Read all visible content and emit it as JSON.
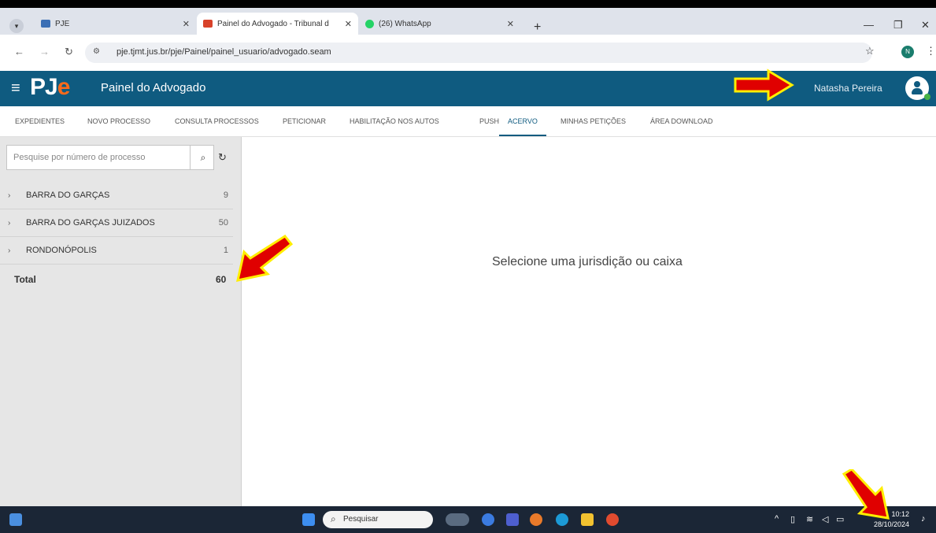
{
  "browser": {
    "tabs": [
      {
        "label": "PJE",
        "active": false
      },
      {
        "label": "Painel do Advogado - Tribunal d",
        "active": true
      },
      {
        "label": "(26) WhatsApp",
        "active": false
      }
    ],
    "url": "pje.tjmt.jus.br/pje/Painel/painel_usuario/advogado.seam",
    "profile_initial": "N"
  },
  "header": {
    "logo_p": "PJ",
    "logo_e": "e",
    "title": "Painel do Advogado",
    "user_name": "Natasha Pereira"
  },
  "nav": [
    "EXPEDIENTES",
    "NOVO PROCESSO",
    "CONSULTA PROCESSOS",
    "PETICIONAR",
    "HABILITAÇÃO NOS AUTOS",
    "PUSH",
    "ACERVO",
    "MINHAS PETIÇÕES",
    "ÁREA DOWNLOAD"
  ],
  "nav_active": "ACERVO",
  "sidebar": {
    "search_placeholder": "Pesquise por número de processo",
    "items": [
      {
        "name": "BARRA DO GARÇAS",
        "count": "9"
      },
      {
        "name": "BARRA DO GARÇAS JUIZADOS",
        "count": "50"
      },
      {
        "name": "RONDONÓPOLIS",
        "count": "1"
      }
    ],
    "total_label": "Total",
    "total_value": "60"
  },
  "main": {
    "placeholder": "Selecione uma jurisdição ou caixa"
  },
  "taskbar": {
    "search_label": "Pesquisar",
    "time": "10:12",
    "date": "28/10/2024"
  },
  "colors": {
    "header_bg": "#0f5b80",
    "logo_accent": "#ff6a1a",
    "annotation_arrow": "#e00000",
    "annotation_outline": "#ffee00"
  }
}
